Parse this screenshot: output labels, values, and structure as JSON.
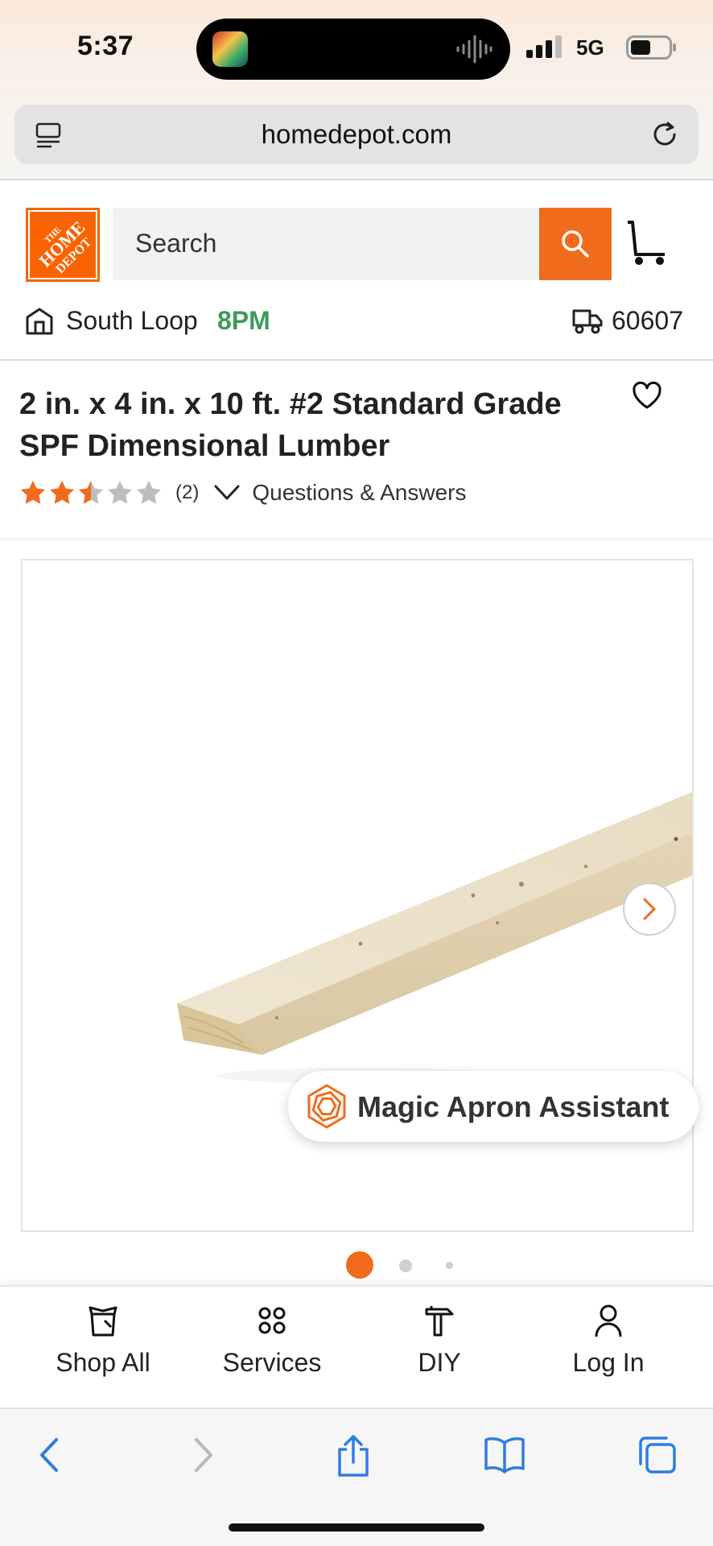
{
  "status_bar": {
    "time": "5:37",
    "network": "5G"
  },
  "browser": {
    "url": "homedepot.com"
  },
  "header": {
    "logo_text": "THE HOME DEPOT",
    "search_placeholder": "Search",
    "brand_color": "#f96302"
  },
  "store": {
    "name": "South Loop",
    "hours": "8PM",
    "zip": "60607"
  },
  "product": {
    "title": "2 in. x 4 in. x 10 ft. #2 Standard Grade SPF Dimensional Lumber",
    "rating": 2.5,
    "rating_max": 5,
    "review_count": "(2)",
    "qa_label": "Questions & Answers",
    "image_count": 3,
    "active_image": 1
  },
  "assistant": {
    "label": "Magic Apron Assistant"
  },
  "bottom_nav": {
    "items": [
      {
        "label": "Shop All",
        "icon": "shop-all-icon"
      },
      {
        "label": "Services",
        "icon": "services-icon"
      },
      {
        "label": "DIY",
        "icon": "diy-hammer-icon"
      },
      {
        "label": "Log In",
        "icon": "user-icon"
      }
    ]
  },
  "colors": {
    "accent": "#f06c1c",
    "store_hours": "#3e9a5a",
    "safari_blue": "#2f7de0"
  }
}
